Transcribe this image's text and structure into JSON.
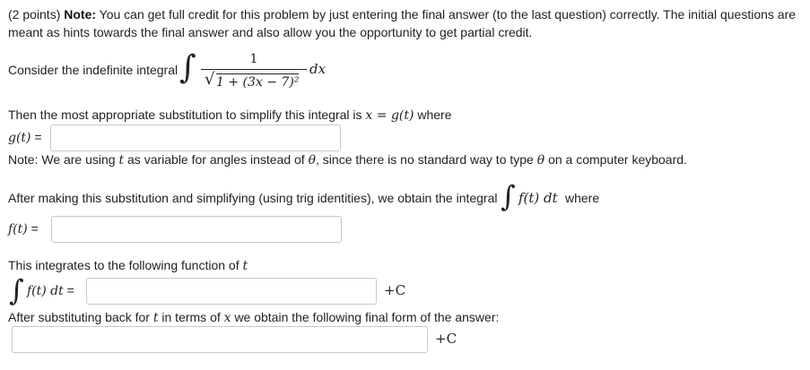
{
  "intro": {
    "points": "(2 points) ",
    "note_label": "Note:",
    "note_text": " You can get full credit for this problem by just entering the final answer (to the last question) correctly. The initial questions are meant as hints towards the final answer and also allow you the opportunity to get partial credit."
  },
  "consider": {
    "label": "Consider the indefinite integral",
    "numerator": "1",
    "radical_content": "1 + (3x − 7)²",
    "dx": "dx"
  },
  "substitution": {
    "text": "Then the most appropriate substitution to simplify this integral is",
    "eq": "x = g(t)",
    "where": "where",
    "g_label": "g(t)",
    "equals": "="
  },
  "note2": {
    "before": "Note: We are using",
    "t": "t",
    "mid": "as variable for angles instead of",
    "theta": "θ",
    "after": ", since there is no standard way to type",
    "theta2": "θ",
    "end": "on a computer keyboard."
  },
  "after_sub": {
    "text": "After making this substitution and simplifying (using trig identities), we obtain the integral",
    "integrand": "f(t) dt",
    "where": "where",
    "f_label": "f(t)",
    "equals": "="
  },
  "integrates": {
    "text": "This integrates to the following function of",
    "t": "t",
    "integrand": "f(t) dt",
    "equals": "=",
    "plus_c": "+C"
  },
  "final": {
    "before": "After substituting back for",
    "t": "t",
    "mid": "in terms of",
    "x": "x",
    "after": "we obtain the following final form of the answer:",
    "plus_c": "+C"
  },
  "inputs": {
    "g_value": "",
    "f_value": "",
    "antiderivative_value": "",
    "final_value": ""
  }
}
